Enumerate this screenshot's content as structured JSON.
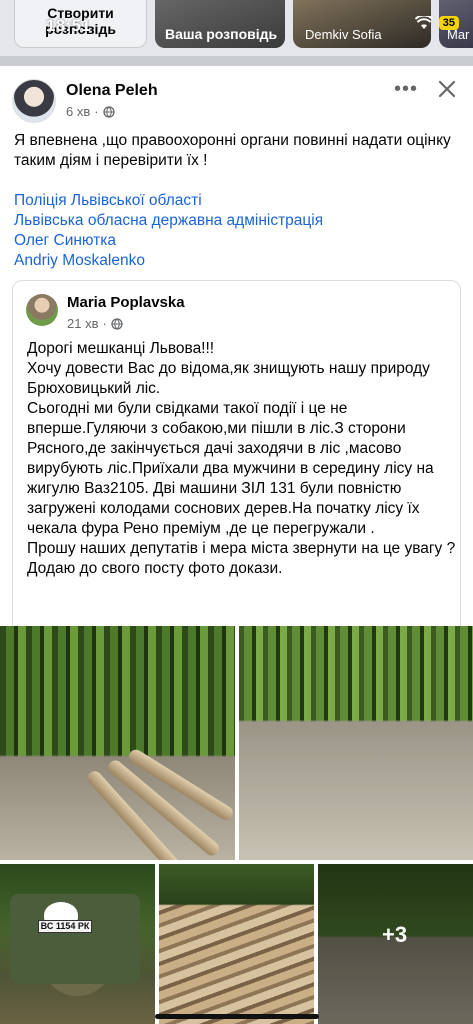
{
  "status_bar": {
    "time": "18:51",
    "battery": "35"
  },
  "stories": {
    "create_label": "Створити розповідь",
    "archive_label": "Ваша розповідь",
    "user_label": "Demkiv Sofia",
    "more_label": "Mar"
  },
  "post": {
    "author": "Olena Peleh",
    "time": "6 хв",
    "text": "Я впевнена ,що правоохоронні органи повинні надати оцінку таким діям і перевірити їх !",
    "tags": [
      "Поліція Львівської області",
      "Львівська обласна державна адміністрація",
      "Олег Синютка",
      "Andriy Moskalenko"
    ]
  },
  "shared_post": {
    "author": "Maria Poplavska",
    "time": "21 хв",
    "paragraphs": [
      "Дорогі мешканці Львова!!!",
      "Хочу довести Вас до відома,як знищують нашу природу Брюховицький ліс.",
      "Сьогодні ми були свідками такої події і це не вперше.Гуляючи з собакою,ми пішли в ліс.З сторони Рясного,де закінчується дачі заходячи в ліс ,масово вирубують ліс.Приїхали два мужчини в середину лісу на жигулю Ваз2105. Дві машини ЗІЛ 131 були повністю загружені колодами соснових дерев.На початку лісу їх чекала фура Рено преміум ,де це перегружали .",
      "Прошу наших депутатів і мера міста звернути на це увагу ?",
      "Додаю до свого посту фото докази."
    ]
  },
  "photos": {
    "more_count": "+3",
    "plate": "ВС 1154 РК"
  },
  "colors": {
    "link": "#1b64d7",
    "meta": "#65676b",
    "battery": "#f3d40b"
  },
  "icons": [
    "globe-icon",
    "more-icon",
    "close-icon",
    "wifi-icon"
  ]
}
